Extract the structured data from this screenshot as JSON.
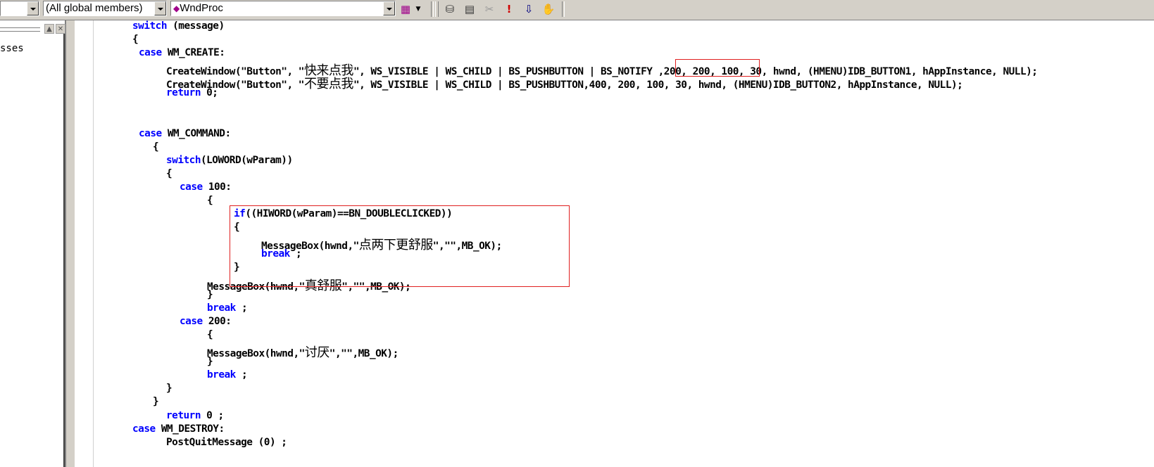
{
  "toolbar": {
    "class_combo": "",
    "members_combo": "(All global members)",
    "function_combo": "WndProc"
  },
  "left_pane": {
    "item": "sses"
  },
  "code": {
    "l1_kw": "switch",
    "l1_rest": " (message)",
    "l2": "{",
    "l3_kw": "case",
    "l3_rest": " WM_CREATE:",
    "l4_a": "CreateWindow(\"Button\", \"",
    "l4_cjk": "快来点我",
    "l4_b": "\", WS_VISIBLE | WS_CHILD | BS_PUSHBUTTON | BS_NOTIFY ,200, 200, 100, 30, hwnd, (HMENU)IDB_BUTTON1, hAppInstance, NULL);",
    "l5_a": "CreateWindow(\"Button\", \"",
    "l5_cjk": "不要点我",
    "l5_b": "\", WS_VISIBLE | WS_CHILD | BS_PUSHBUTTON,400, 200, 100, 30, hwnd, (HMENU)IDB_BUTTON2, hAppInstance, NULL);",
    "l6_kw": "return",
    "l6_rest": " 0;",
    "l7_kw": "case",
    "l7_rest": " WM_COMMAND:",
    "l8": "{",
    "l9_kw": "switch",
    "l9_rest": "(LOWORD(wParam))",
    "l10": "{",
    "l11_kw": "case",
    "l11_rest": " 100:",
    "l12": "{",
    "l13_kw": "if",
    "l13_rest": "((HIWORD(wParam)==BN_DOUBLECLICKED))",
    "l14": "{",
    "l15_a": "MessageBox(hwnd,\"",
    "l15_cjk": "点两下更舒服",
    "l15_b": "\",\"\",MB_OK);",
    "l16_kw": "break",
    "l16_rest": " ;",
    "l17": "}",
    "l18_a": "MessageBox(hwnd,\"",
    "l18_cjk": "真舒服",
    "l18_b": "\",\"\",MB_OK);",
    "l19": "}",
    "l20_kw": "break",
    "l20_rest": " ;",
    "l21_kw": "case",
    "l21_rest": " 200:",
    "l22": "{",
    "l23_a": "MessageBox(hwnd,\"",
    "l23_cjk": "讨厌",
    "l23_b": "\",\"\",MB_OK);",
    "l24": "}",
    "l25_kw": "break",
    "l25_rest": " ;",
    "l26": "}",
    "l27": "}",
    "l28_kw": "return",
    "l28_rest": " 0 ;",
    "l29_kw": "case",
    "l29_rest": " WM_DESTROY:",
    "l30": "PostQuitMessage (0) ;"
  },
  "colors": {
    "keyword": "#0000ff",
    "highlight_box": "#e02020",
    "chrome": "#d4d0c8"
  }
}
